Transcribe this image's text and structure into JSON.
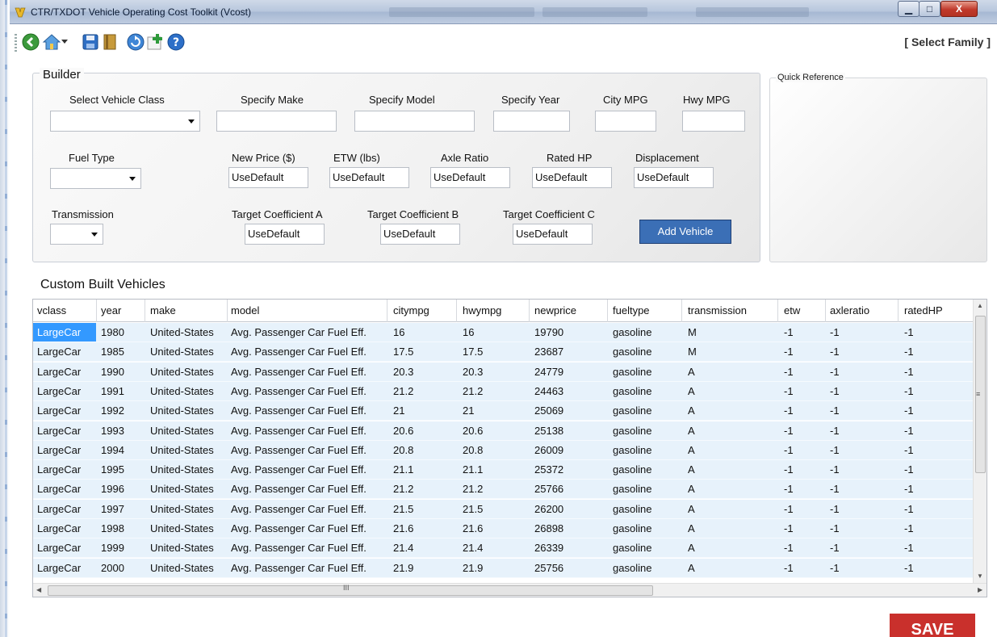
{
  "window": {
    "title": "CTR/TXDOT Vehicle Operating Cost Toolkit (Vcost)",
    "min_glyph": "▁",
    "max_glyph": "□",
    "close_glyph": "X"
  },
  "toolbar": {
    "select_family": "[ Select Family ]",
    "icons": [
      "back-icon",
      "home-icon",
      "dropdown-arrow-icon",
      "save-icon",
      "book-icon",
      "refresh-icon",
      "add-icon",
      "help-icon"
    ]
  },
  "builder": {
    "legend": "Builder",
    "vehicle_class_label": "Select Vehicle Class",
    "make_label": "Specify Make",
    "model_label": "Specify Model",
    "year_label": "Specify Year",
    "city_mpg_label": "City MPG",
    "hwy_mpg_label": "Hwy MPG",
    "fuel_type_label": "Fuel Type",
    "new_price_label": "New Price ($)",
    "etw_label": "ETW (lbs)",
    "axle_ratio_label": "Axle Ratio",
    "rated_hp_label": "Rated HP",
    "displacement_label": "Displacement",
    "transmission_label": "Transmission",
    "coef_a_label": "Target Coefficient A",
    "coef_b_label": "Target Coefficient B",
    "coef_c_label": "Target Coefficient C",
    "new_price_value": "UseDefault",
    "etw_value": "UseDefault",
    "axle_ratio_value": "UseDefault",
    "rated_hp_value": "UseDefault",
    "displacement_value": "UseDefault",
    "coef_a_value": "UseDefault",
    "coef_b_value": "UseDefault",
    "coef_c_value": "UseDefault",
    "add_vehicle": "Add Vehicle"
  },
  "quick_reference": {
    "legend": "Quick Reference"
  },
  "grid": {
    "caption": "Custom Built Vehicles",
    "columns": [
      "vclass",
      "year",
      "make",
      "model",
      "citympg",
      "hwympg",
      "newprice",
      "fueltype",
      "transmission",
      "etw",
      "axleratio",
      "ratedHP"
    ],
    "rows": [
      [
        "LargeCar",
        "1980",
        "United-States",
        "Avg. Passenger Car Fuel Eff.",
        "16",
        "16",
        "19790",
        "gasoline",
        "M",
        "-1",
        "-1",
        "-1"
      ],
      [
        "LargeCar",
        "1985",
        "United-States",
        "Avg. Passenger Car Fuel Eff.",
        "17.5",
        "17.5",
        "23687",
        "gasoline",
        "M",
        "-1",
        "-1",
        "-1"
      ],
      [
        "LargeCar",
        "1990",
        "United-States",
        "Avg. Passenger Car Fuel Eff.",
        "20.3",
        "20.3",
        "24779",
        "gasoline",
        "A",
        "-1",
        "-1",
        "-1"
      ],
      [
        "LargeCar",
        "1991",
        "United-States",
        "Avg. Passenger Car Fuel Eff.",
        "21.2",
        "21.2",
        "24463",
        "gasoline",
        "A",
        "-1",
        "-1",
        "-1"
      ],
      [
        "LargeCar",
        "1992",
        "United-States",
        "Avg. Passenger Car Fuel Eff.",
        "21",
        "21",
        "25069",
        "gasoline",
        "A",
        "-1",
        "-1",
        "-1"
      ],
      [
        "LargeCar",
        "1993",
        "United-States",
        "Avg. Passenger Car Fuel Eff.",
        "20.6",
        "20.6",
        "25138",
        "gasoline",
        "A",
        "-1",
        "-1",
        "-1"
      ],
      [
        "LargeCar",
        "1994",
        "United-States",
        "Avg. Passenger Car Fuel Eff.",
        "20.8",
        "20.8",
        "26009",
        "gasoline",
        "A",
        "-1",
        "-1",
        "-1"
      ],
      [
        "LargeCar",
        "1995",
        "United-States",
        "Avg. Passenger Car Fuel Eff.",
        "21.1",
        "21.1",
        "25372",
        "gasoline",
        "A",
        "-1",
        "-1",
        "-1"
      ],
      [
        "LargeCar",
        "1996",
        "United-States",
        "Avg. Passenger Car Fuel Eff.",
        "21.2",
        "21.2",
        "25766",
        "gasoline",
        "A",
        "-1",
        "-1",
        "-1"
      ],
      [
        "LargeCar",
        "1997",
        "United-States",
        "Avg. Passenger Car Fuel Eff.",
        "21.5",
        "21.5",
        "26200",
        "gasoline",
        "A",
        "-1",
        "-1",
        "-1"
      ],
      [
        "LargeCar",
        "1998",
        "United-States",
        "Avg. Passenger Car Fuel Eff.",
        "21.6",
        "21.6",
        "26898",
        "gasoline",
        "A",
        "-1",
        "-1",
        "-1"
      ],
      [
        "LargeCar",
        "1999",
        "United-States",
        "Avg. Passenger Car Fuel Eff.",
        "21.4",
        "21.4",
        "26339",
        "gasoline",
        "A",
        "-1",
        "-1",
        "-1"
      ],
      [
        "LargeCar",
        "2000",
        "United-States",
        "Avg. Passenger Car Fuel Eff.",
        "21.9",
        "21.9",
        "25756",
        "gasoline",
        "A",
        "-1",
        "-1",
        "-1"
      ]
    ],
    "scroll_grip": "≡",
    "hscroll_grip": "III",
    "arrow_up": "▲",
    "arrow_down": "▼",
    "arrow_left": "◀",
    "arrow_right": "▶"
  },
  "save": "SAVE",
  "colors": {
    "accent": "#3b6fb6",
    "selection": "#3399ff",
    "row": "#e7f2fb",
    "save": "#c9302c"
  }
}
